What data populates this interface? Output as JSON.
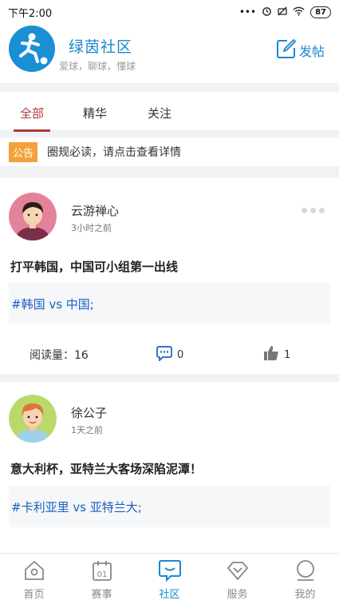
{
  "status_bar": {
    "time": "下午2:00",
    "battery": "87"
  },
  "header": {
    "title": "绿茵社区",
    "subtitle": "爱球，聊球，懂球",
    "post_button": "发帖"
  },
  "tabs": [
    {
      "label": "全部",
      "active": true
    },
    {
      "label": "精华",
      "active": false
    },
    {
      "label": "关注",
      "active": false
    }
  ],
  "notice": {
    "tag": "公告",
    "text": "圈规必读，请点击查看详情"
  },
  "posts": [
    {
      "author": "云游禅心",
      "time": "3小时之前",
      "title": "打平韩国，中国可小组第一出线",
      "topic": "#韩国 vs 中国;",
      "reads_label": "阅读量：16",
      "comments": "0",
      "likes": "1"
    },
    {
      "author": "徐公子",
      "time": "1天之前",
      "title": "意大利杯，亚特兰大客场深陷泥潭！",
      "topic": "#卡利亚里 vs 亚特兰大;"
    }
  ],
  "bottom_nav": [
    {
      "label": "首页",
      "icon": "home-icon",
      "active": false
    },
    {
      "label": "赛事",
      "icon": "calendar-icon",
      "calendar_number": "01",
      "active": false
    },
    {
      "label": "社区",
      "icon": "chat-icon",
      "active": true
    },
    {
      "label": "服务",
      "icon": "diamond-icon",
      "active": false
    },
    {
      "label": "我的",
      "icon": "profile-icon",
      "active": false
    }
  ],
  "colors": {
    "accent": "#1b87d0",
    "tab_active": "#b23a3c",
    "notice_tag": "#f2a23a",
    "topic": "#1b5fc1"
  }
}
